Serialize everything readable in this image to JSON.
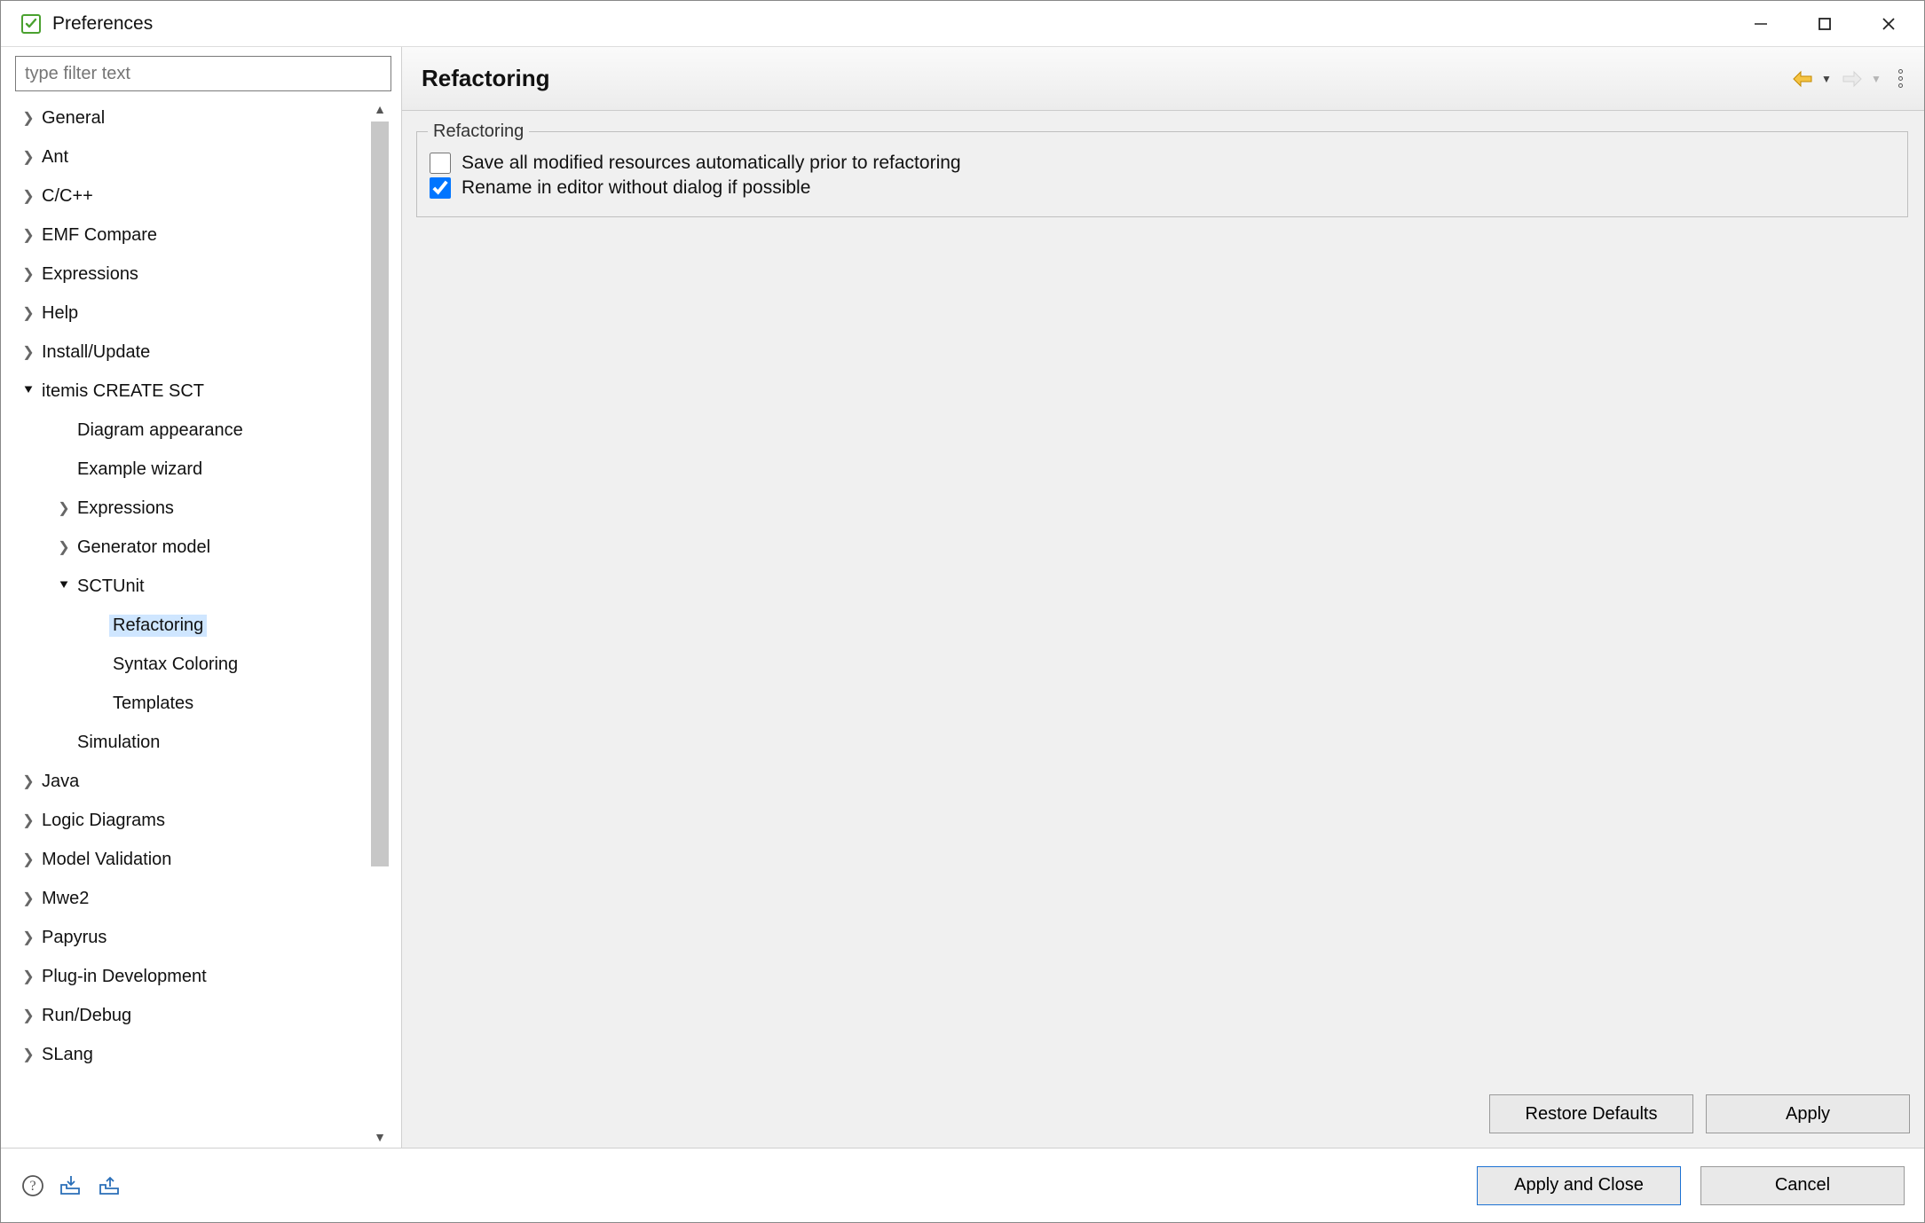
{
  "window": {
    "title": "Preferences"
  },
  "filter": {
    "placeholder": "type filter text"
  },
  "tree": {
    "general": "General",
    "ant": "Ant",
    "ccpp": "C/C++",
    "emf": "EMF Compare",
    "expressions": "Expressions",
    "help": "Help",
    "install": "Install/Update",
    "itemis": "itemis CREATE SCT",
    "itemis_diagram": "Diagram appearance",
    "itemis_example": "Example wizard",
    "itemis_expressions": "Expressions",
    "itemis_generator": "Generator model",
    "itemis_sctunit": "SCTUnit",
    "itemis_refactoring": "Refactoring",
    "itemis_syntax": "Syntax Coloring",
    "itemis_templates": "Templates",
    "itemis_simulation": "Simulation",
    "java": "Java",
    "logic": "Logic Diagrams",
    "modelval": "Model Validation",
    "mwe2": "Mwe2",
    "papyrus": "Papyrus",
    "plugin": "Plug-in Development",
    "rundebug": "Run/Debug",
    "slang": "SLang"
  },
  "page": {
    "title": "Refactoring",
    "group_label": "Refactoring",
    "opt_save_all": {
      "label": "Save all modified resources automatically prior to refactoring",
      "checked": false
    },
    "opt_rename": {
      "label": "Rename in editor without dialog if possible",
      "checked": true
    }
  },
  "buttons": {
    "restore_defaults": "Restore Defaults",
    "apply": "Apply",
    "apply_close": "Apply and Close",
    "cancel": "Cancel"
  }
}
